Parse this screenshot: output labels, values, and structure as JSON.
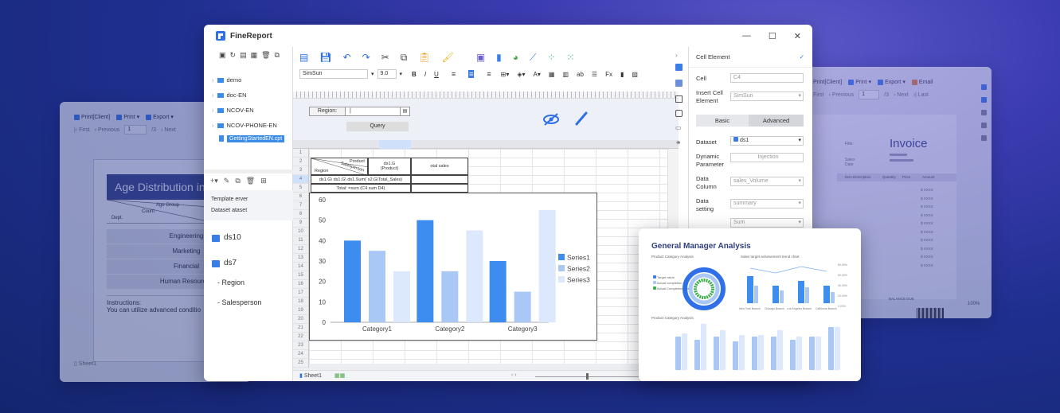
{
  "left_window": {
    "toolbar": {
      "print_client": "Print[Client]",
      "print": "Print",
      "export": "Export"
    },
    "nav": {
      "first": "First",
      "previous": "Previous",
      "page": "1",
      "total": "/3",
      "next": "Next"
    },
    "report_title": "Age Distribution in",
    "header_age_group": "Age Group",
    "header_count": "Count",
    "header_dept": "Dept.",
    "departments": [
      "Engineering",
      "Marketing",
      "Financial",
      "Human Resources"
    ],
    "instructions": "Instructions:",
    "instructions_text": "You can utilize advanced conditio",
    "sheet": "Sheet1"
  },
  "right_window": {
    "toolbar": {
      "print_client": "Print[Client]",
      "print": "Print",
      "export": "Export",
      "email": "Email"
    },
    "nav": {
      "first": "First",
      "previous": "Previous",
      "page": "1",
      "total": "/3",
      "next": "Next",
      "last": "Last"
    },
    "invoice_title": "Invoice",
    "columns": [
      "Item Description",
      "Quantity",
      "Price",
      "Amount"
    ],
    "amount_placeholder": "$ XXXX",
    "balance_due": "BALANCE DUE",
    "zoom": "100%",
    "small_labels": [
      "Fitle:",
      "Sales",
      "Date"
    ]
  },
  "main_window": {
    "app_name": "FineReport",
    "tree": [
      "demo",
      "doc-EN",
      "NCOV-EN",
      "NCOV-PHONE-EN",
      "GettingStartedEN.cpt"
    ],
    "font_name": "SimSun",
    "font_size": "9.0",
    "dataset_panel": {
      "template_server": "Template erver",
      "dataset": "Dataset ataset",
      "ds10": "ds10",
      "ds7": "ds7",
      "region": "- Region",
      "salesperson": "- Salesperson"
    },
    "param": {
      "region_label": "Region:",
      "query_button": "Query"
    },
    "cells": {
      "product": "Product",
      "region": "Region",
      "dept": "Salesperson",
      "ds1g": "ds1.G\n(Product)",
      "total_sales": "otal sales",
      "row3": "ds1.G\\ ds1.G\\ ds1.Sum(`s2.G\\Total_Sales)",
      "row4": "Total: =sum (C4 sum D4)"
    },
    "row_numbers": [
      "1",
      "2",
      "3",
      "4",
      "5",
      "6",
      "7",
      "8",
      "9",
      "10",
      "11",
      "12",
      "13",
      "14",
      "15",
      "16",
      "17",
      "18",
      "19",
      "20",
      "21",
      "22",
      "23",
      "24",
      "25"
    ],
    "sheet": "Sheet1",
    "properties": {
      "title": "Cell Element",
      "cell_label": "Cell",
      "cell_value": "C4",
      "insert_label": "Insert Cell Element",
      "insert_value": "SimSun",
      "tab_basic": "Basic",
      "tab_advanced": "Advanced",
      "dataset_label": "Dataset",
      "dataset_value": "ds1",
      "dynamic_label": "Dynamic Parameter",
      "dynamic_value": "Injection",
      "data_column_label": "Data Column",
      "data_column_value": "sales_Volume",
      "data_setting_label": "Data setting",
      "data_setting_value": "summary",
      "sum_value": "Sum"
    }
  },
  "gm_window": {
    "title": "General Manager Analysis",
    "left_chart_title": "Product Category Analysis",
    "right_chart_title": "Sales target achievement trend chart",
    "bottom_chart_title": "Product Category Analysis",
    "donut_legend": [
      "Target value",
      "Actual completion",
      "Actual Completion Rate"
    ],
    "branches": [
      "New York Branch",
      "Chicago Branch",
      "Los Angeles Branch",
      "California Branch"
    ],
    "right_axis": [
      "80.00%",
      "60.00%",
      "40.00%",
      "20.00%",
      "0.00%"
    ]
  },
  "chart_data": {
    "type": "bar",
    "categories": [
      "Category1",
      "Category2",
      "Category3"
    ],
    "series": [
      {
        "name": "Series1",
        "values": [
          40,
          50,
          30
        ],
        "color": "#3d8cf0"
      },
      {
        "name": "Series2",
        "values": [
          35,
          25,
          15
        ],
        "color": "#a9c8f6"
      },
      {
        "name": "Series3",
        "values": [
          25,
          45,
          55
        ],
        "color": "#dce8fb"
      }
    ],
    "ylim": [
      0,
      60
    ],
    "yticks": [
      0,
      10,
      20,
      30,
      40,
      50,
      60
    ],
    "legend": "right",
    "grid": false
  }
}
